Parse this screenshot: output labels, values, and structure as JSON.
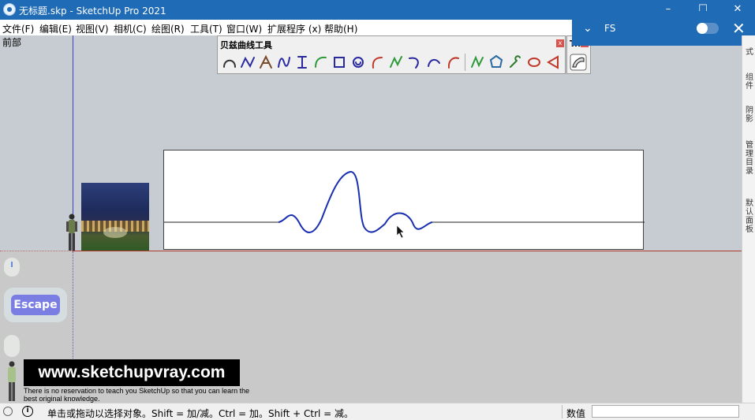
{
  "titlebar": {
    "title": "无标题.skp - SketchUp Pro 2021",
    "minimize": "–",
    "maximize": "☐",
    "close": "✕"
  },
  "menu": [
    "文件(F)",
    "编辑(E)",
    "视图(V)",
    "相机(C)",
    "绘图(R)",
    "工具(T)",
    "窗口(W)",
    "扩展程序 (x)",
    "帮助(H)"
  ],
  "viewport": {
    "scene_label": "前部"
  },
  "bezier_toolbar": {
    "title": "贝兹曲线工具",
    "close": "x"
  },
  "small_toolbar": {
    "title": "T..",
    "close": "x"
  },
  "fs_panel": {
    "label": "FS",
    "chevron": "⌄",
    "close": "✕"
  },
  "right_tray": {
    "tabs": [
      "式",
      "组件",
      "阴影",
      "管理目录",
      "默认面板"
    ]
  },
  "overlay": {
    "escape_label": "Escape",
    "watermark": "www.sketchupvray.com",
    "watermark_sub": "There is no reservation to teach you SketchUp so that you can learn the best original knowledge."
  },
  "statusbar": {
    "hint": "单击或拖动以选择对象。Shift = 加/减。Ctrl = 加。Shift + Ctrl = 减。",
    "info_icon": "i",
    "value_label": "数值",
    "value": ""
  },
  "colors": {
    "title_blue": "#1f6bb5",
    "curve_blue": "#1a2fb0",
    "red_axis": "#b03a2e"
  },
  "icons": {
    "bezier_tools": [
      "bezier-arc-icon",
      "bezier-curve-icon",
      "bezier-edit-icon",
      "spline-icon",
      "bspline-icon",
      "arc-3pt-icon",
      "rounded-rect-icon",
      "spiral-icon",
      "arc-open-icon",
      "polyline-curve-icon",
      "fillet-icon",
      "arc-curve-icon",
      "arc-red-icon",
      "freehand-icon",
      "polygon-icon",
      "wrench-icon",
      "ellipse-icon",
      "segment-icon"
    ]
  }
}
